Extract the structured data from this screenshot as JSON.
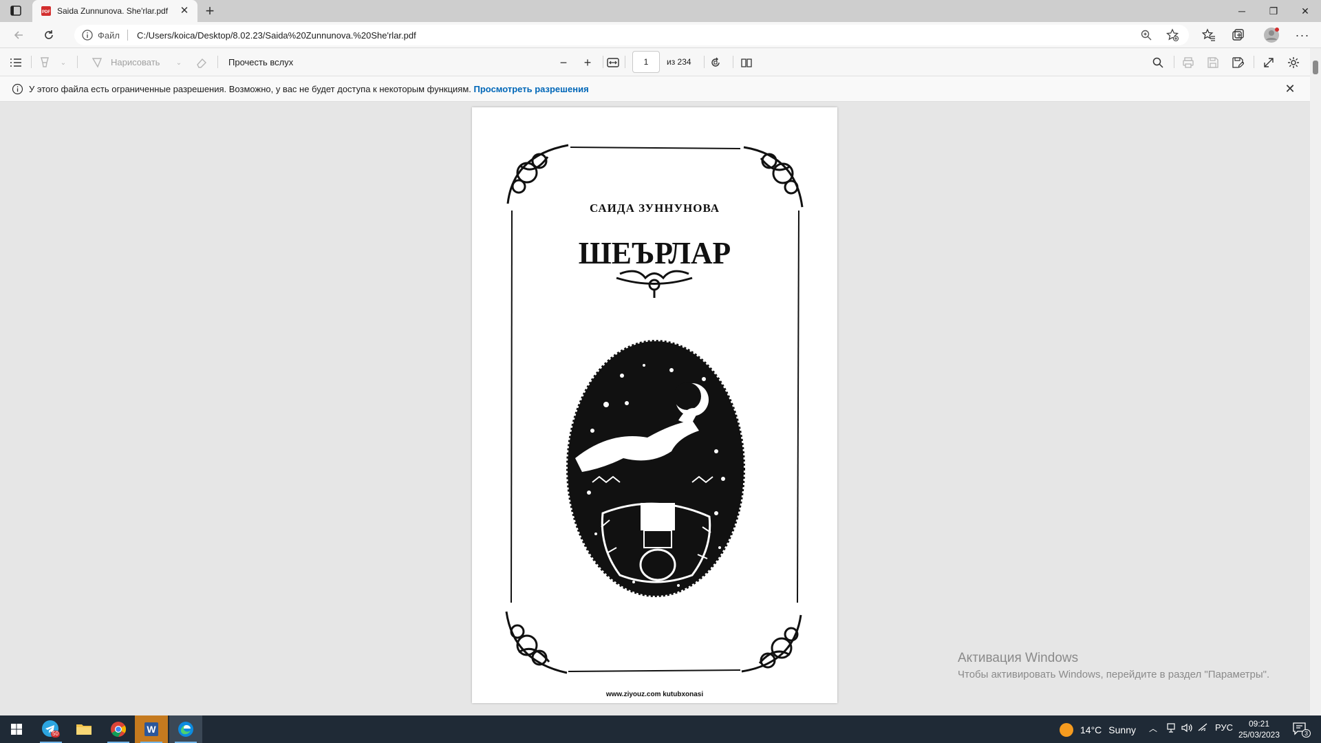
{
  "browser": {
    "tab_title": "Saida Zunnunova. She'rlar.pdf",
    "address_prefix": "Файл",
    "url": "C:/Users/koica/Desktop/8.02.23/Saida%20Zunnunova.%20She'rlar.pdf"
  },
  "pdf_toolbar": {
    "draw_label": "Нарисовать",
    "read_aloud_label": "Прочесть вслух",
    "current_page": "1",
    "page_total": "из 234"
  },
  "infobar": {
    "message": "У этого файла есть ограниченные разрешения. Возможно, у вас не будет доступа к некоторым функциям.",
    "link": "Просмотреть разрешения"
  },
  "document": {
    "author": "САИДА ЗУННУНОВА",
    "title": "ШЕЪРЛАР",
    "footer": "www.ziyouz.com kutubxonasi"
  },
  "watermark": {
    "line1": "Активация Windows",
    "line2": "Чтобы активировать Windows, перейдите в раздел \"Параметры\"."
  },
  "taskbar": {
    "telegram_badge": "50",
    "weather_temp": "14°C",
    "weather_desc": "Sunny",
    "language": "РУС",
    "time": "09:21",
    "date": "25/03/2023",
    "notification_count": "3"
  },
  "colors": {
    "accent_link": "#0067b8",
    "taskbar_bg": "#1f2a36",
    "pdf_icon_red": "#d32f2f"
  }
}
